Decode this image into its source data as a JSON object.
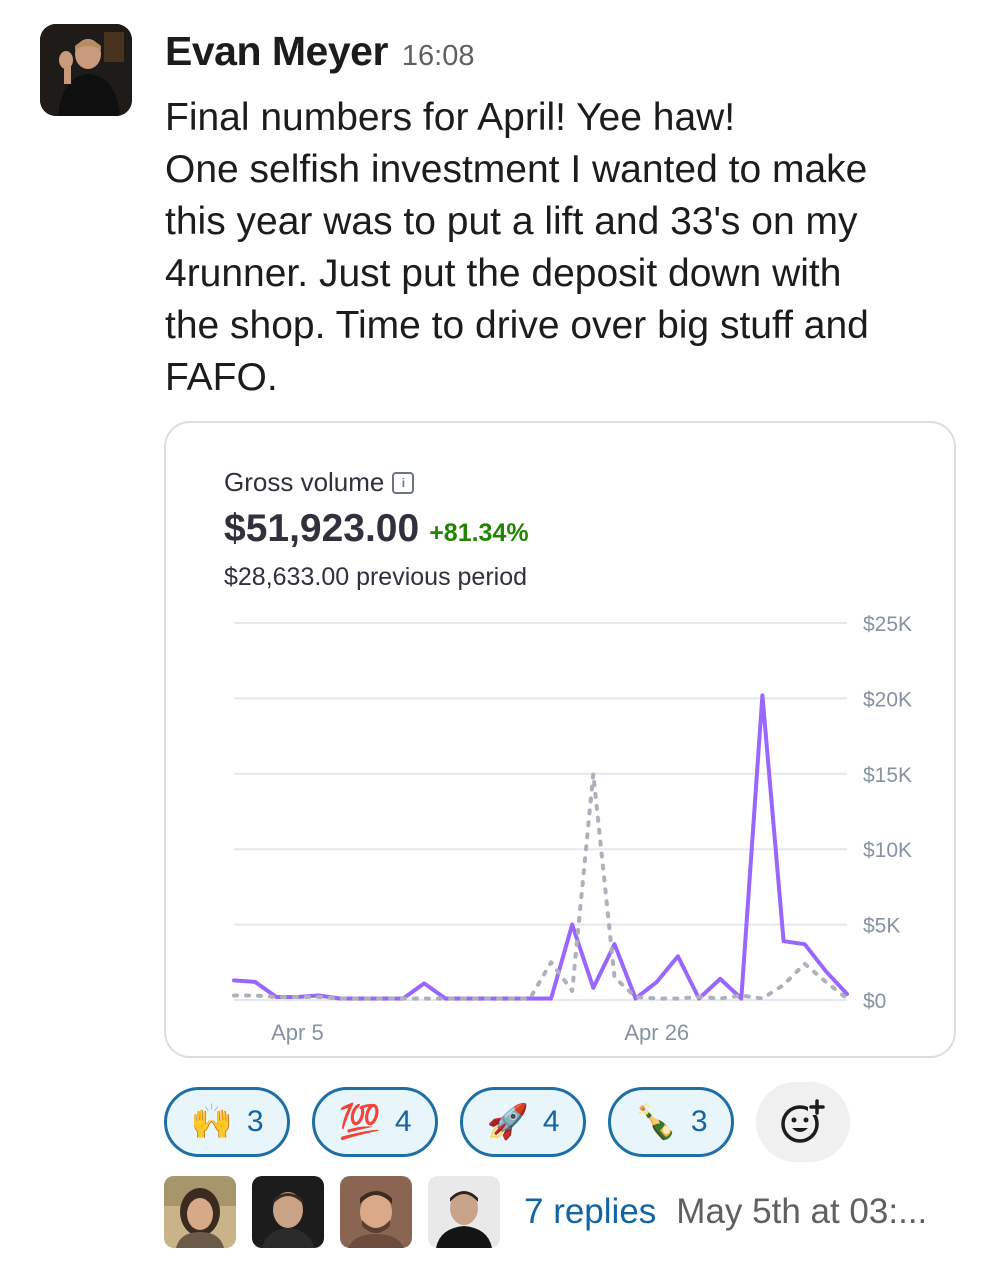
{
  "message": {
    "author": "Evan Meyer",
    "time": "16:08",
    "lines": [
      "Final numbers for April! Yee haw!",
      "One selfish investment I wanted to make",
      "this year was to put a lift and 33's on my",
      "4runner. Just put the deposit down with",
      "the shop. Time to drive over big stuff and",
      "FAFO."
    ]
  },
  "card": {
    "label": "Gross volume",
    "amount": "$51,923.00",
    "change": "+81.34%",
    "previous": "$28,633.00 previous period",
    "icon": "info-icon"
  },
  "chart_data": {
    "type": "line",
    "title": "Gross volume",
    "x_ticks": [
      "Apr 5",
      "Apr 26"
    ],
    "y_ticks": [
      "$25K",
      "$20K",
      "$15K",
      "$10K",
      "$5K",
      "$0"
    ],
    "ylim": [
      0,
      25000
    ],
    "grid": true,
    "colors": {
      "current": "#9966ff",
      "previous": "#aeb1b9",
      "grid": "#e3e8ee"
    },
    "series": [
      {
        "style": "solid",
        "points": [
          [
            0,
            1300
          ],
          [
            1,
            1200
          ],
          [
            2,
            200
          ],
          [
            3,
            200
          ],
          [
            4,
            300
          ],
          [
            5,
            100
          ],
          [
            6,
            100
          ],
          [
            7,
            100
          ],
          [
            8,
            100
          ],
          [
            9,
            1100
          ],
          [
            10,
            100
          ],
          [
            11,
            100
          ],
          [
            12,
            100
          ],
          [
            13,
            100
          ],
          [
            14,
            100
          ],
          [
            15,
            100
          ],
          [
            16,
            5000
          ],
          [
            17,
            800
          ],
          [
            18,
            3700
          ],
          [
            19,
            100
          ],
          [
            20,
            1200
          ],
          [
            21,
            2900
          ],
          [
            22,
            100
          ],
          [
            23,
            1400
          ],
          [
            24,
            100
          ],
          [
            25,
            20200
          ],
          [
            26,
            3900
          ],
          [
            27,
            3700
          ],
          [
            28,
            1900
          ],
          [
            29,
            400
          ]
        ]
      },
      {
        "style": "dotted",
        "points": [
          [
            0,
            300
          ],
          [
            1,
            300
          ],
          [
            2,
            200
          ],
          [
            3,
            200
          ],
          [
            4,
            200
          ],
          [
            5,
            100
          ],
          [
            6,
            100
          ],
          [
            7,
            100
          ],
          [
            8,
            100
          ],
          [
            9,
            100
          ],
          [
            10,
            100
          ],
          [
            11,
            100
          ],
          [
            12,
            100
          ],
          [
            13,
            100
          ],
          [
            14,
            100
          ],
          [
            15,
            2500
          ],
          [
            16,
            600
          ],
          [
            17,
            15000
          ],
          [
            18,
            1500
          ],
          [
            19,
            200
          ],
          [
            20,
            100
          ],
          [
            21,
            100
          ],
          [
            22,
            200
          ],
          [
            23,
            100
          ],
          [
            24,
            300
          ],
          [
            25,
            100
          ],
          [
            26,
            1000
          ],
          [
            27,
            2400
          ],
          [
            28,
            1200
          ],
          [
            29,
            100
          ]
        ]
      }
    ]
  },
  "reactions": [
    {
      "emoji": "🙌",
      "count": "3",
      "icon": "raised-hands-icon"
    },
    {
      "emoji": "💯",
      "count": "4",
      "icon": "hundred-points-icon"
    },
    {
      "emoji": "🚀",
      "count": "4",
      "icon": "rocket-icon"
    },
    {
      "emoji": "🍾",
      "count": "3",
      "icon": "champagne-icon"
    }
  ],
  "add_reaction_icon": "add-reaction-icon",
  "thread": {
    "replies": "7 replies",
    "last_reply": "May 5th at 03:..."
  }
}
